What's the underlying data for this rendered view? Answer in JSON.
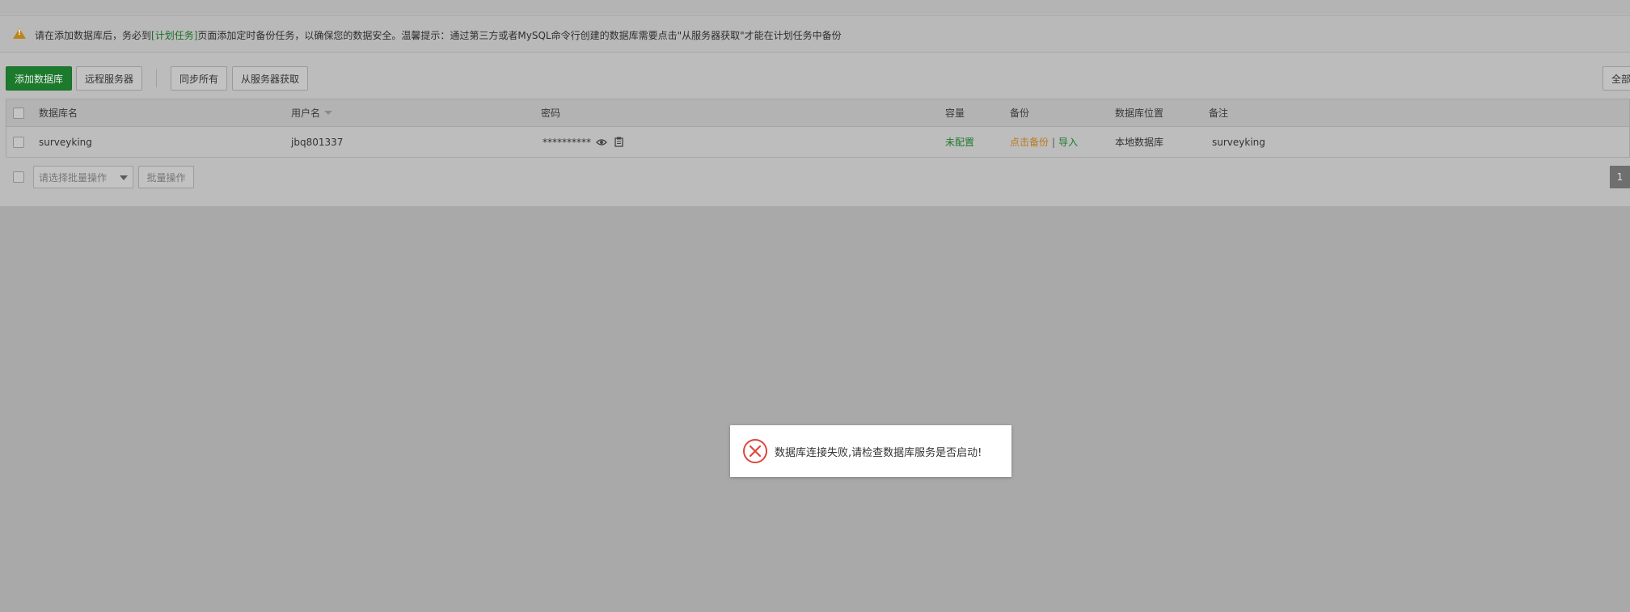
{
  "notice": {
    "prefix": "请在添加数据库后，务必到",
    "link": "[计划任务]",
    "suffix": "页面添加定时备份任务，以确保您的数据安全。温馨提示：通过第三方或者MySQL命令行创建的数据库需要点击\"从服务器获取\"才能在计划任务中备份",
    "icon": "warning-icon"
  },
  "toolbar": {
    "add_db": "添加数据库",
    "remote_server": "远程服务器",
    "sync_all": "同步所有",
    "fetch_from_server": "从服务器获取",
    "right_button": "全部"
  },
  "table": {
    "headers": {
      "name": "数据库名",
      "user": "用户名",
      "password": "密码",
      "capacity": "容量",
      "backup": "备份",
      "location": "数据库位置",
      "note": "备注"
    },
    "rows": [
      {
        "name": "surveyking",
        "user": "jbq801337",
        "password": "**********",
        "capacity": "未配置",
        "backup_action": "点击备份",
        "backup_sep": "|",
        "import_action": "导入",
        "location": "本地数据库",
        "note": "surveyking"
      }
    ]
  },
  "batch": {
    "select_placeholder": "请选择批量操作",
    "button": "批量操作"
  },
  "pagination": {
    "current": "1"
  },
  "toast": {
    "message": "数据库连接失败,请检查数据库服务是否启动!",
    "icon": "error-circle-icon"
  },
  "colors": {
    "primary_green": "#1c7a2c",
    "overlay": "#a9a9a9",
    "error_red": "#e0463a",
    "warning_orange": "#b8861c"
  }
}
